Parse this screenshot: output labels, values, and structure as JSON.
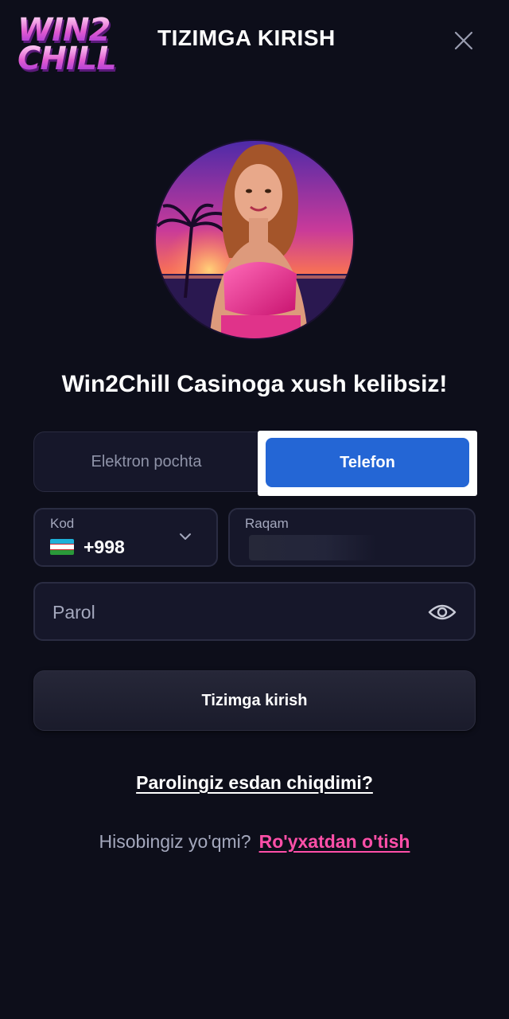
{
  "header": {
    "logo_line1": "WIN2",
    "logo_line2": "CHILL",
    "title": "TIZIMGA KIRISH",
    "close_icon": "close-icon"
  },
  "hero": {
    "avatar": "casino-host-avatar",
    "welcome": "Win2Chill Casinoga xush kelibsiz!"
  },
  "tabs": {
    "email_label": "Elektron pochta",
    "phone_label": "Telefon",
    "active": "phone"
  },
  "form": {
    "code_label": "Kod",
    "code_value": "+998",
    "flag": "uzbekistan-flag",
    "number_label": "Raqam",
    "number_value": "",
    "password_placeholder": "Parol",
    "eye_icon": "eye-icon",
    "submit_label": "Tizimga kirish"
  },
  "links": {
    "forgot": "Parolingiz esdan chiqdimi?",
    "register_question": "Hisobingiz yo'qmi?",
    "register_link": "Ro'yxatdan o'tish"
  },
  "colors": {
    "background": "#0d0e1a",
    "accent_blue": "#2466d5",
    "register_pink": "#ff4fa8"
  }
}
